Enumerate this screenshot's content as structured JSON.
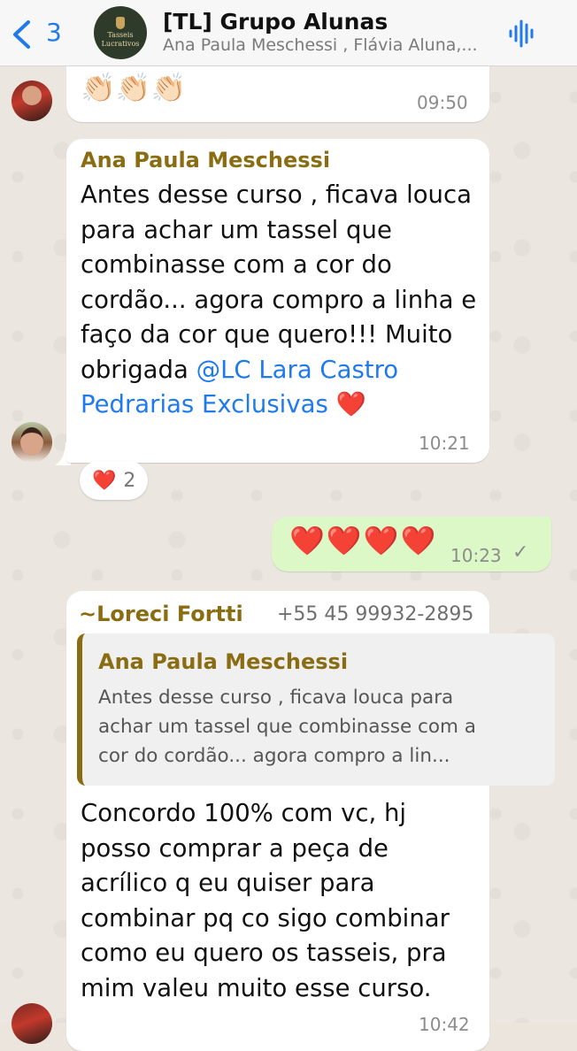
{
  "header": {
    "back_count": "3",
    "title": "[TL] Grupo Alunas",
    "subtitle": "Ana Paula Meschessi , Flávia Aluna,...",
    "avatar_text_1": "Tasseis",
    "avatar_text_2": "Lucrativos"
  },
  "messages": {
    "m1": {
      "emoji": "👏🏻👏🏻👏🏻",
      "time": "09:50"
    },
    "m2": {
      "sender": "Ana Paula Meschessi",
      "text": "Antes desse curso , ficava louca para achar um tassel que combinasse com a cor do cordão... agora compro a linha e faço da cor que quero!!! Muito obrigada ",
      "mention": "@LC Lara Castro Pedrarias Exclusivas",
      "end_emoji": " ❤️",
      "time": "10:21",
      "reaction_emoji": "❤️",
      "reaction_count": "2"
    },
    "m3": {
      "text": "❤️❤️❤️❤️",
      "time": "10:23",
      "check": "✓"
    },
    "m4": {
      "sender": "~Loreci Fortti",
      "phone": "+55 45 99932-2895",
      "quote_sender": "Ana Paula Meschessi",
      "quote_text": "Antes desse curso , ficava louca para achar um tassel que combinasse com a cor do cordão... agora compro a lin...",
      "text": "Concordo 100% com vc, hj posso comprar a peça de acrílico q eu quiser para combinar pq co sigo combinar como eu quero os tasseis, pra mim valeu muito esse curso.",
      "time": "10:42"
    }
  },
  "colors": {
    "accent": "#1f7aec",
    "sender": "#8a6d12",
    "outgoing": "#dcf8c6",
    "background": "#ebe6df"
  }
}
